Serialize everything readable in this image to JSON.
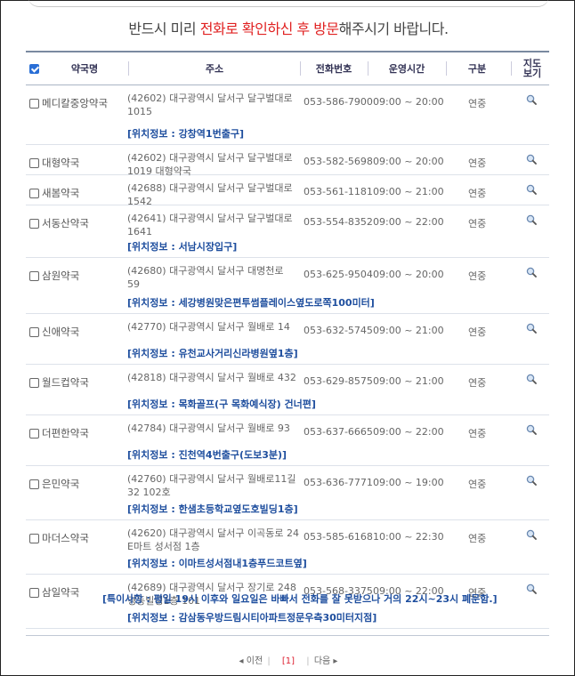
{
  "notice": {
    "part1": "반드시 미리 ",
    "part2": "전화로 확인하신 후 방문",
    "part3": "해주시기 바랍니다."
  },
  "header": {
    "name": "약국명",
    "address": "주소",
    "phone": "전화번호",
    "hours": "운영시간",
    "category": "구분",
    "map_line1": "지도",
    "map_line2": "보기"
  },
  "rows": [
    {
      "name": "메디칼중앙약국",
      "addr1": "(42602) 대구광역시 달서구 달구벌대로",
      "addr2": "1015",
      "phone": "053-586-7900",
      "hours": "09:00 ~ 20:00",
      "kind": "연중",
      "loc": "[위치정보 : 강창역1번출구]"
    },
    {
      "name": "대형약국",
      "addr1": "(42602) 대구광역시 달서구 달구벌대로",
      "addr2": "1019 대형약국",
      "phone": "053-582-5698",
      "hours": "09:00 ~ 20:00",
      "kind": "연중",
      "loc": ""
    },
    {
      "name": "새봄약국",
      "addr1": "(42688) 대구광역시 달서구 달구벌대로",
      "addr2": "1542",
      "phone": "053-561-1181",
      "hours": "09:00 ~ 21:00",
      "kind": "연중",
      "loc": ""
    },
    {
      "name": "서동산약국",
      "addr1": "(42641) 대구광역시 달서구 달구벌대로",
      "addr2": "1641",
      "phone": "053-554-8352",
      "hours": "09:00 ~ 22:00",
      "kind": "연중",
      "loc": "[위치정보 : 서남시장입구]"
    },
    {
      "name": "삼원약국",
      "addr1": "(42680) 대구광역시 달서구 대명천로",
      "addr2": "59",
      "phone": "053-625-9504",
      "hours": "09:00 ~ 20:00",
      "kind": "연중",
      "loc": "[위치정보 : 세강병원맞은편투썸플레이스옆도로쪽100미터]"
    },
    {
      "name": "신애약국",
      "addr1": "(42770) 대구광역시 달서구 월배로 14",
      "addr2": "",
      "phone": "053-632-5745",
      "hours": "09:00 ~ 21:00",
      "kind": "연중",
      "loc": "[위치정보 : 유천교사거리신라병원옆1층]"
    },
    {
      "name": "월드컵약국",
      "addr1": "(42818) 대구광역시 달서구 월배로 432",
      "addr2": "",
      "phone": "053-629-8575",
      "hours": "09:00 ~ 21:00",
      "kind": "연중",
      "loc": "[위치정보 : 목화골프(구 목화예식장) 건너편]"
    },
    {
      "name": "더편한약국",
      "addr1": "(42784) 대구광역시 달서구 월배로 93",
      "addr2": "",
      "phone": "053-637-6665",
      "hours": "09:00 ~ 22:00",
      "kind": "연중",
      "loc": "[위치정보 : 진천역4번출구(도보3분)]"
    },
    {
      "name": "은민약국",
      "addr1": "(42760) 대구광역시 달서구 월배로11길",
      "addr2": "32 102호",
      "phone": "053-636-7771",
      "hours": "09:00 ~ 19:00",
      "kind": "연중",
      "loc": "[위치정보 : 한샘초등학교옆도호빌딩1층]"
    },
    {
      "name": "마더스약국",
      "addr1": "(42620) 대구광역시 달서구 이곡동로 24",
      "addr2": "E마트 성서점 1층",
      "phone": "053-585-6168",
      "hours": "10:00 ~ 22:30",
      "kind": "연중",
      "loc": "[위치정보 : 이마트성서점내1층푸드코트옆]"
    },
    {
      "name": "삼일약국",
      "addr1": "(42689) 대구광역시 달서구 장기로 248",
      "addr2": "경동빌딩1층 101",
      "phone": "053-568-3375",
      "hours": "09:00 ~ 22:00",
      "kind": "연중",
      "loc": "[위치정보 : 감삼동우방드림시티아파트정문우측30미터지점]"
    }
  ],
  "special": "[특이사항 : 평일 19시 이후와 일요일은 바빠서 전화를 잘 못받으나 거의 22시~23시 폐문함.]",
  "pager": {
    "prev": "◂ 이전",
    "current": "[1]",
    "next": "다음 ▸"
  },
  "colors": {
    "accent_red": "#e02020",
    "link_blue": "#1e4e9e",
    "checkbox_blue": "#2a6fd6"
  }
}
